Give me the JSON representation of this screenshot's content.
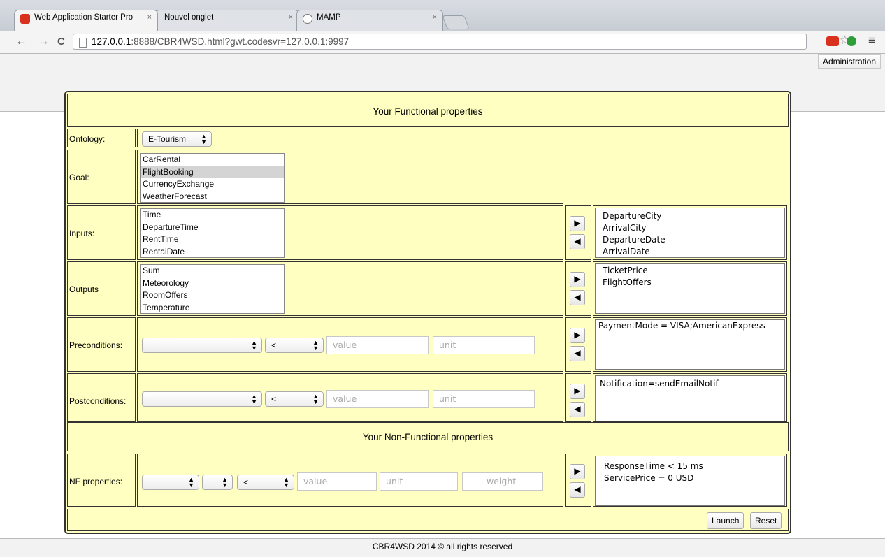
{
  "browser": {
    "tabs": [
      {
        "title": "Web Application Starter Pro",
        "close": "×"
      },
      {
        "title": "Nouvel onglet",
        "close": "×"
      },
      {
        "title": "MAMP",
        "close": "×"
      }
    ],
    "url_host": "127.0.0.1",
    "url_rest": ":8888/CBR4WSD.html?gwt.codesvr=127.0.0.1:9997",
    "back": "←",
    "forward": "→",
    "reload": "C",
    "menu": "≡",
    "star": "☆"
  },
  "app": {
    "admin_label": "Administration",
    "footer": "CBR4WSD 2014 © all rights reserved",
    "functional_header": "Your Functional properties",
    "nonfunctional_header": "Your Non-Functional properties",
    "ontology": {
      "label": "Ontology:",
      "value": "E-Tourism"
    },
    "goal": {
      "label": "Goal:",
      "options": [
        "CarRental",
        "FlightBooking",
        "CurrencyExchange",
        "WeatherForecast"
      ],
      "selected": "FlightBooking"
    },
    "inputs": {
      "label": "Inputs:",
      "available": [
        "Time",
        "DepartureTime",
        "RentTime",
        "RentalDate"
      ],
      "chosen": [
        "DepartureCity",
        "ArrivalCity",
        "DepartureDate",
        "ArrivalDate"
      ]
    },
    "outputs": {
      "label": "Outputs",
      "available": [
        "Sum",
        "Meteorology",
        "RoomOffers",
        "Temperature"
      ],
      "chosen": [
        "TicketPrice",
        "FlightOffers"
      ]
    },
    "preconditions": {
      "label": "Preconditions:",
      "operator": "<",
      "value_placeholder": "value",
      "unit_placeholder": "unit",
      "chosen": [
        "PaymentMode = VISA;AmericanExpress"
      ]
    },
    "postconditions": {
      "label": "Postconditions:",
      "operator": "<",
      "value_placeholder": "value",
      "unit_placeholder": "unit",
      "chosen": [
        "Notification=sendEmailNotif"
      ]
    },
    "nf": {
      "label": "NF properties:",
      "operator": "<",
      "value_placeholder": "value",
      "unit_placeholder": "unit",
      "weight_placeholder": "weight",
      "chosen": [
        "ResponseTime < 15 ms",
        "ServicePrice = 0 USD"
      ]
    },
    "arrows": {
      "right": "▶",
      "left": "◀"
    },
    "launch_label": "Launch",
    "reset_label": "Reset"
  }
}
